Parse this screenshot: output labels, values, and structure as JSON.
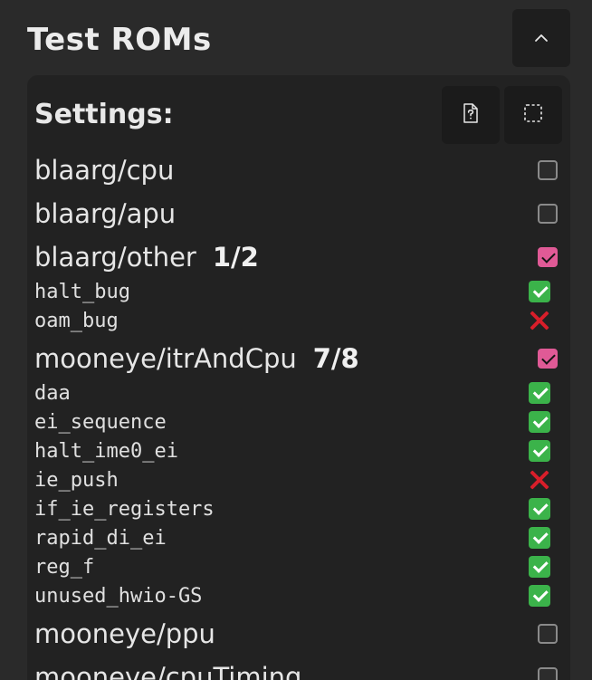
{
  "header": {
    "title": "Test ROMs"
  },
  "panel": {
    "settings_label": "Settings:"
  },
  "groups": [
    {
      "name": "blaarg/cpu",
      "count": "",
      "checked": false
    },
    {
      "name": "blaarg/apu",
      "count": "",
      "checked": false
    },
    {
      "name": "blaarg/other",
      "count": "1/2",
      "checked": true
    },
    {
      "name": "mooneye/itrAndCpu",
      "count": "7/8",
      "checked": true
    },
    {
      "name": "mooneye/ppu",
      "count": "",
      "checked": false
    },
    {
      "name": "mooneye/cpuTiming",
      "count": "",
      "checked": false
    }
  ],
  "tests": {
    "blaarg_other": [
      {
        "name": "halt_bug",
        "status": "pass"
      },
      {
        "name": "oam_bug",
        "status": "fail"
      }
    ],
    "mooneye_itrAndCpu": [
      {
        "name": "daa",
        "status": "pass"
      },
      {
        "name": "ei_sequence",
        "status": "pass"
      },
      {
        "name": "halt_ime0_ei",
        "status": "pass"
      },
      {
        "name": "ie_push",
        "status": "fail"
      },
      {
        "name": "if_ie_registers",
        "status": "pass"
      },
      {
        "name": "rapid_di_ei",
        "status": "pass"
      },
      {
        "name": "reg_f",
        "status": "pass"
      },
      {
        "name": "unused_hwio-GS",
        "status": "pass"
      }
    ]
  },
  "icons": {
    "collapse": "chevron-up-icon",
    "help": "file-question-icon",
    "select": "dashed-selection-icon",
    "pass": "check-mark-icon",
    "fail": "cross-mark-icon"
  },
  "colors": {
    "accent": "#e05a96",
    "pass": "#3bb34a",
    "fail": "#d81e2a"
  }
}
